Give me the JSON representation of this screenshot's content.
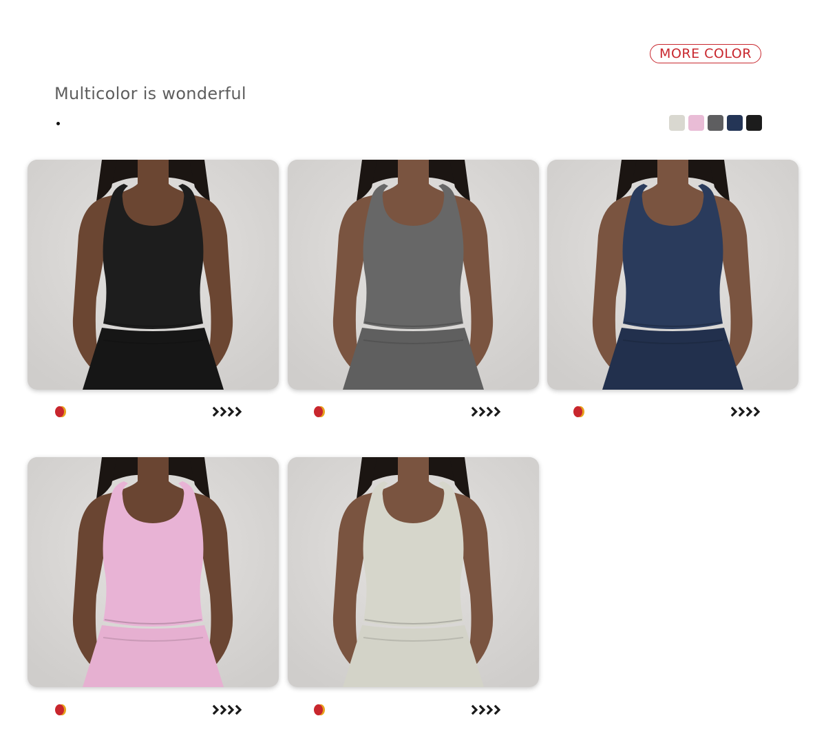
{
  "header": {
    "more_color_label": "MORE COLOR",
    "headline": "Multicolor is wonderful"
  },
  "swatches": [
    {
      "name": "beige",
      "color": "#d9d8d0"
    },
    {
      "name": "pink",
      "color": "#e9bcd6"
    },
    {
      "name": "gray",
      "color": "#5e5e60"
    },
    {
      "name": "navy",
      "color": "#243556"
    },
    {
      "name": "black",
      "color": "#1c1c1c"
    }
  ],
  "products": [
    {
      "color_name": "black",
      "top_color": "#1d1d1d",
      "skirt_color": "#161616",
      "skin": "#6b4632"
    },
    {
      "color_name": "gray",
      "top_color": "#676767",
      "skirt_color": "#5f5f5f",
      "skin": "#7a5440"
    },
    {
      "color_name": "navy",
      "top_color": "#2a3b5c",
      "skirt_color": "#22304d",
      "skin": "#7a5440"
    },
    {
      "color_name": "pink",
      "top_color": "#e8b3d5",
      "skirt_color": "#e6b0d1",
      "skin": "#6a4532"
    },
    {
      "color_name": "beige",
      "top_color": "#d6d6cb",
      "skirt_color": "#d3d3c8",
      "skin": "#7a5440"
    }
  ],
  "icons": {
    "marker": "color-marker-icon",
    "arrows": "chevrons-right-icon"
  }
}
